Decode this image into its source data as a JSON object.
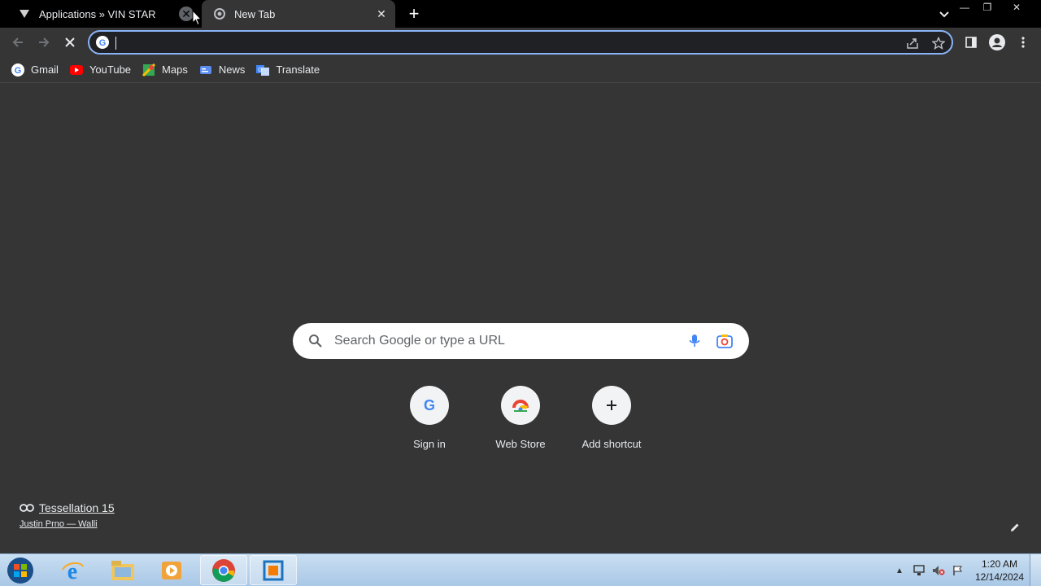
{
  "tabs": [
    {
      "title": "Applications » VIN STAR",
      "icon": "vinstar-favicon",
      "active": false
    },
    {
      "title": "New Tab",
      "icon": "chrome-newtab-favicon",
      "active": true
    }
  ],
  "window_controls": {
    "minimize": "—",
    "restore": "❐",
    "close": "✕"
  },
  "omnibox": {
    "value": "",
    "placeholder": ""
  },
  "bookmarks": [
    {
      "label": "Gmail",
      "icon": "google-icon"
    },
    {
      "label": "YouTube",
      "icon": "youtube-icon"
    },
    {
      "label": "Maps",
      "icon": "maps-icon"
    },
    {
      "label": "News",
      "icon": "news-icon"
    },
    {
      "label": "Translate",
      "icon": "translate-icon"
    }
  ],
  "ntp": {
    "search_placeholder": "Search Google or type a URL",
    "shortcuts": [
      {
        "label": "Sign in",
        "icon": "google-icon"
      },
      {
        "label": "Web Store",
        "icon": "webstore-icon"
      },
      {
        "label": "Add shortcut",
        "icon": "plus-icon"
      }
    ],
    "attribution": {
      "title": "Tessellation 15",
      "author": "Justin Prno — Walli"
    }
  },
  "taskbar": {
    "apps": [
      "internet-explorer-icon",
      "file-explorer-icon",
      "media-player-icon",
      "chrome-icon",
      "virtualbox-icon"
    ],
    "clock_time": "1:20 AM",
    "clock_date": "12/14/2024"
  },
  "colors": {
    "accent": "#8ab4f8",
    "background": "#353535",
    "tabstrip": "#000000"
  }
}
